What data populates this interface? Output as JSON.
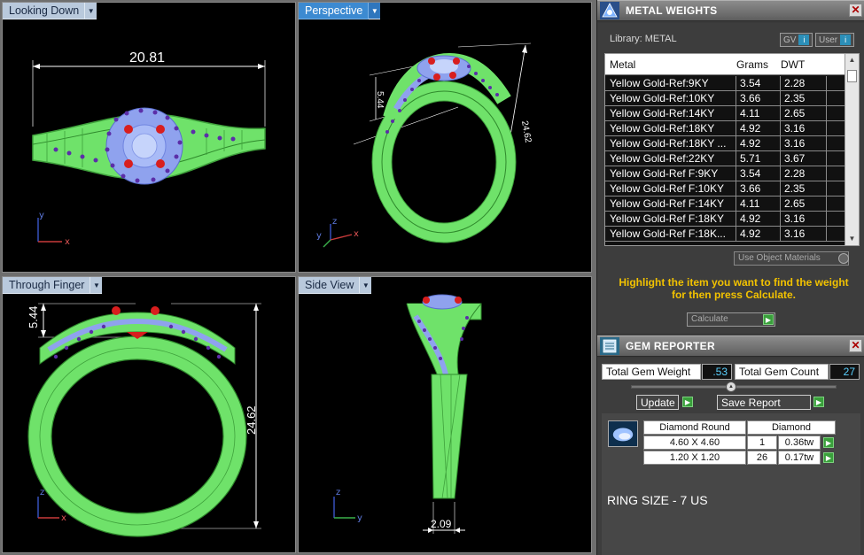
{
  "viewports": {
    "top": {
      "label": "Looking Down",
      "dim_width": "20.81",
      "axis_v": "y",
      "axis_h": "x"
    },
    "perspective": {
      "label": "Perspective",
      "dim_a": "5.44",
      "dim_b": "24.62",
      "axis_v": "z",
      "axis_h": "x",
      "axis_d": "y"
    },
    "front": {
      "label": "Through Finger",
      "dim_height": "5.44",
      "dim_total": "24.62",
      "axis_v": "z",
      "axis_h": "x"
    },
    "side": {
      "label": "Side View",
      "dim_shank": "2.09",
      "axis_v": "z",
      "axis_h": "y"
    }
  },
  "metal_weights": {
    "title": "METAL WEIGHTS",
    "library_label": "Library: METAL",
    "gv_label": "GV",
    "user_label": "User",
    "columns": [
      "Metal",
      "Grams",
      "DWT"
    ],
    "rows": [
      [
        "Yellow Gold-Ref:9KY",
        "3.54",
        "2.28"
      ],
      [
        "Yellow Gold-Ref:10KY",
        "3.66",
        "2.35"
      ],
      [
        "Yellow Gold-Ref:14KY",
        "4.11",
        "2.65"
      ],
      [
        "Yellow Gold-Ref:18KY",
        "4.92",
        "3.16"
      ],
      [
        "Yellow Gold-Ref:18KY ...",
        "4.92",
        "3.16"
      ],
      [
        "Yellow Gold-Ref:22KY",
        "5.71",
        "3.67"
      ],
      [
        "Yellow Gold-Ref F:9KY",
        "3.54",
        "2.28"
      ],
      [
        "Yellow Gold-Ref F:10KY",
        "3.66",
        "2.35"
      ],
      [
        "Yellow Gold-Ref F:14KY",
        "4.11",
        "2.65"
      ],
      [
        "Yellow Gold-Ref F:18KY",
        "4.92",
        "3.16"
      ],
      [
        "Yellow Gold-Ref F:18K...",
        "4.92",
        "3.16"
      ]
    ],
    "use_object_materials": "Use Object Materials",
    "instruction": "Highlight the item you want to find the weight for then press Calculate.",
    "calculate_label": "Calculate"
  },
  "gem_reporter": {
    "title": "GEM REPORTER",
    "total_weight_label": "Total Gem Weight",
    "total_weight_value": ".53",
    "total_count_label": "Total Gem Count",
    "total_count_value": "27",
    "update_label": "Update",
    "save_label": "Save Report",
    "shape_label": "Diamond Round",
    "material_label": "Diamond",
    "gems": [
      {
        "size": "4.60 X 4.60",
        "count": "1",
        "weight": "0.36tw"
      },
      {
        "size": "1.20 X 1.20",
        "count": "26",
        "weight": "0.17tw"
      }
    ],
    "ring_size": "RING SIZE - 7 US"
  },
  "colors": {
    "metal_wire": "#7ff07a",
    "metal_dark": "#2f9a33",
    "stone_blue": "#8fa2ee",
    "ruby": "#d81e1e",
    "accent_purple": "#5b2ea8",
    "active_viewport": "#3c8ad1",
    "instruction_text": "#f2c200"
  }
}
